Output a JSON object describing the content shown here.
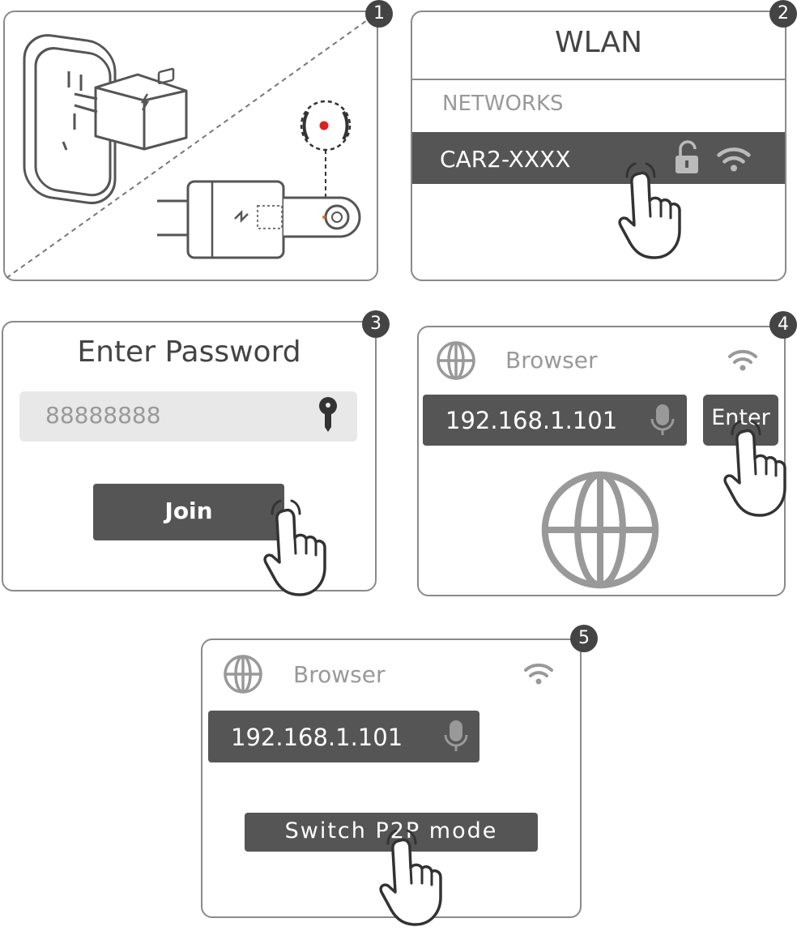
{
  "steps": [
    "1",
    "2",
    "3",
    "4",
    "5"
  ],
  "panel2": {
    "title": "WLAN",
    "section_label": "NETWORKS",
    "network_name": "CAR2-XXXX"
  },
  "panel3": {
    "title": "Enter Password",
    "password_value": "88888888",
    "join_label": "Join"
  },
  "panel4": {
    "app_title": "Browser",
    "url": "192.168.1.101",
    "enter_label": "Enter"
  },
  "panel5": {
    "app_title": "Browser",
    "url": "192.168.1.101",
    "switch_label": "Switch P2P mode"
  },
  "icons": {
    "globe": "globe-icon",
    "wifi": "wifi-icon",
    "lock": "lock-icon",
    "key": "key-icon",
    "mic": "microphone-icon",
    "hand": "pointing-hand-icon"
  },
  "colors": {
    "dark_bar": "#555555",
    "red_dot": "#e02020",
    "border": "#8a8a8a"
  }
}
